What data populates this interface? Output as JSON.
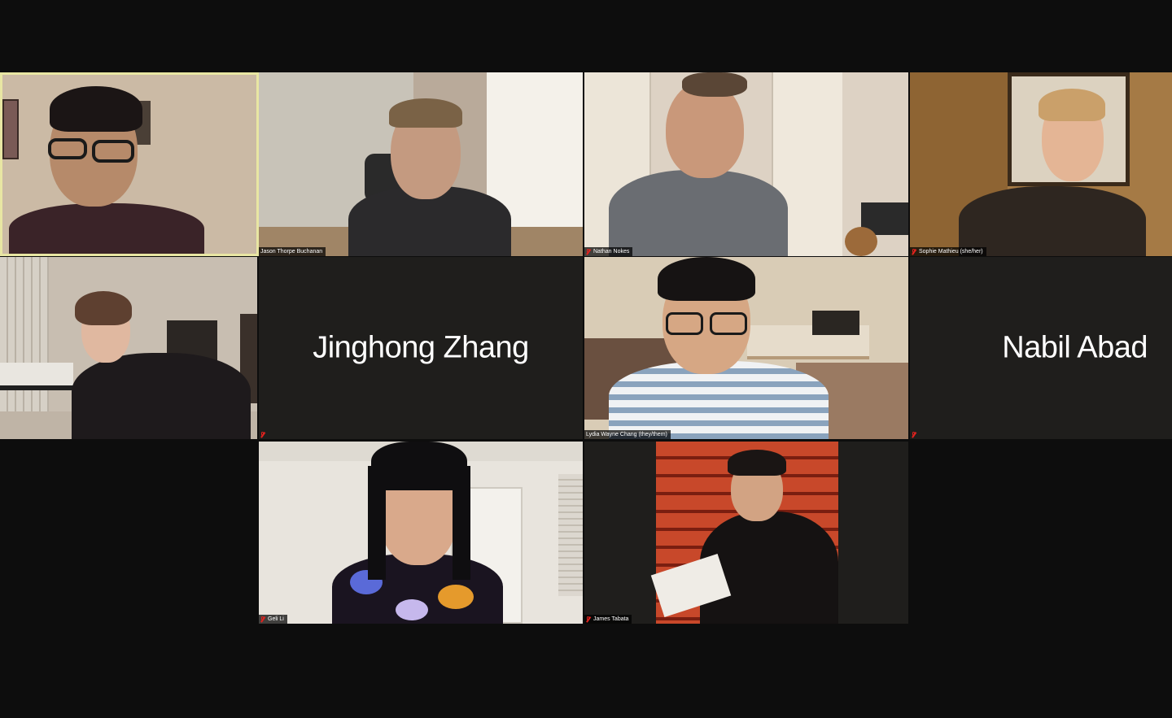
{
  "participants": [
    {
      "id": "p1",
      "name": "",
      "active": true
    },
    {
      "id": "p2",
      "name": "Jason Thorpe Buchanan",
      "muted": false
    },
    {
      "id": "p3",
      "name": "Nathan Nokes",
      "muted": true
    },
    {
      "id": "p4",
      "name": "Sophie Mathieu (she/her)",
      "muted": true
    },
    {
      "id": "p5",
      "name": "",
      "muted": false
    },
    {
      "id": "p6",
      "name": "Jinghong Zhang",
      "video_off": true,
      "muted": true
    },
    {
      "id": "p7",
      "name": "Lydia Wayne Chang (they/them)",
      "muted": false
    },
    {
      "id": "p8",
      "name": "Nabil Abad",
      "video_off": true,
      "muted": true
    },
    {
      "id": "p9",
      "name": "Geli Li",
      "muted": true
    },
    {
      "id": "p10",
      "name": "James Tabata",
      "muted": true
    }
  ],
  "colors": {
    "background": "#0d0d0d",
    "tile_off": "#1f1e1c",
    "active_border": "#e8e6a3",
    "muted_icon": "#e0221e"
  },
  "icons": {
    "muted": "mic-muted-icon"
  }
}
